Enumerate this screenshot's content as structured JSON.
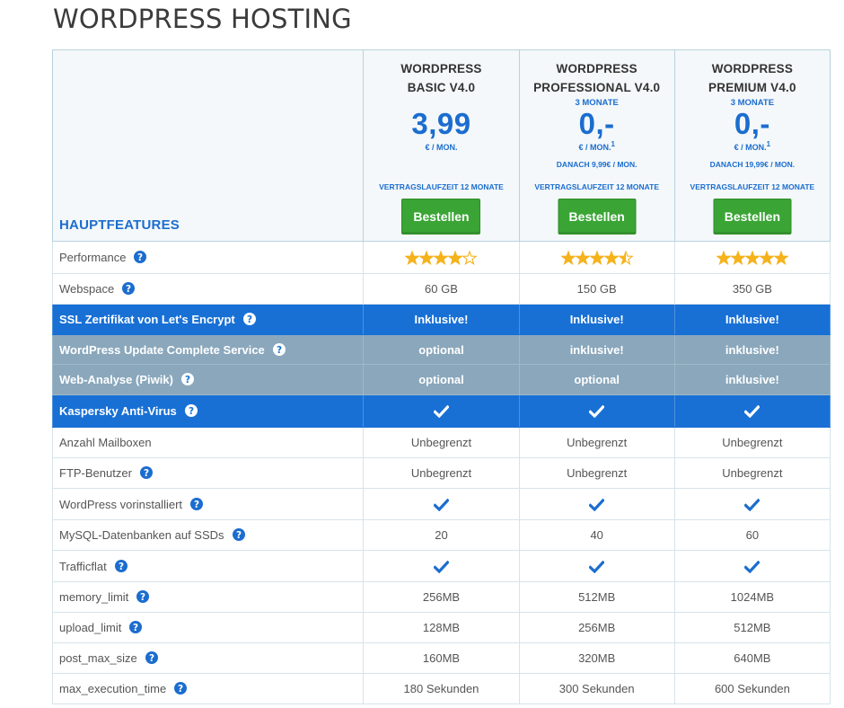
{
  "page": {
    "title": "WORDPRESS HOSTING"
  },
  "table": {
    "feature_header": "HAUPTFEATURES",
    "plans": [
      {
        "name_line1": "WORDPRESS",
        "name_line2": "BASIC V4.0",
        "promo": "",
        "price": "3,99",
        "per": "€ / MON.",
        "footnote": "",
        "after": "",
        "term": "VERTRAGSLAUFZEIT 12 MONATE",
        "order_label": "Bestellen"
      },
      {
        "name_line1": "WORDPRESS",
        "name_line2": "PROFESSIONAL V4.0",
        "promo": "3 MONATE",
        "price": "0,-",
        "per": "€ / MON.",
        "footnote": "1",
        "after": "DANACH 9,99€ / MON.",
        "term": "VERTRAGSLAUFZEIT 12 MONATE",
        "order_label": "Bestellen"
      },
      {
        "name_line1": "WORDPRESS",
        "name_line2": "PREMIUM V4.0",
        "promo": "3 MONATE",
        "price": "0,-",
        "per": "€ / MON.",
        "footnote": "1",
        "after": "DANACH 19,99€ / MON.",
        "term": "VERTRAGSLAUFZEIT 12 MONATE",
        "order_label": "Bestellen"
      }
    ],
    "rows": [
      {
        "label": "Performance",
        "help": true,
        "style": "white",
        "kind": "stars",
        "values": [
          4,
          4.5,
          5
        ]
      },
      {
        "label": "Webspace",
        "help": true,
        "style": "white",
        "kind": "text",
        "values": [
          "60 GB",
          "150 GB",
          "350 GB"
        ]
      },
      {
        "label": "SSL Zertifikat von Let's Encrypt",
        "help": true,
        "style": "blue",
        "kind": "text",
        "values": [
          "Inklusive!",
          "Inklusive!",
          "Inklusive!"
        ]
      },
      {
        "label": "WordPress Update Complete Service",
        "help": true,
        "style": "gray",
        "kind": "text",
        "values": [
          "optional",
          "inklusive!",
          "inklusive!"
        ]
      },
      {
        "label": "Web-Analyse (Piwik)",
        "help": true,
        "style": "gray",
        "kind": "text",
        "values": [
          "optional",
          "optional",
          "inklusive!"
        ]
      },
      {
        "label": "Kaspersky Anti-Virus",
        "help": true,
        "style": "blue",
        "kind": "check",
        "values": [
          true,
          true,
          true
        ]
      },
      {
        "label": "Anzahl Mailboxen",
        "help": false,
        "style": "white",
        "kind": "text",
        "values": [
          "Unbegrenzt",
          "Unbegrenzt",
          "Unbegrenzt"
        ]
      },
      {
        "label": "FTP-Benutzer",
        "help": true,
        "style": "white",
        "kind": "text",
        "values": [
          "Unbegrenzt",
          "Unbegrenzt",
          "Unbegrenzt"
        ]
      },
      {
        "label": "WordPress vorinstalliert",
        "help": true,
        "style": "white",
        "kind": "check",
        "values": [
          true,
          true,
          true
        ]
      },
      {
        "label": "MySQL-Datenbanken auf SSDs",
        "help": true,
        "style": "white",
        "kind": "text",
        "values": [
          "20",
          "40",
          "60"
        ]
      },
      {
        "label": "Trafficflat",
        "help": true,
        "style": "white",
        "kind": "check",
        "values": [
          true,
          true,
          true
        ]
      },
      {
        "label": "memory_limit",
        "help": true,
        "style": "white",
        "kind": "text",
        "values": [
          "256MB",
          "512MB",
          "1024MB"
        ]
      },
      {
        "label": "upload_limit",
        "help": true,
        "style": "white",
        "kind": "text",
        "values": [
          "128MB",
          "256MB",
          "512MB"
        ]
      },
      {
        "label": "post_max_size",
        "help": true,
        "style": "white",
        "kind": "text",
        "values": [
          "160MB",
          "320MB",
          "640MB"
        ]
      },
      {
        "label": "max_execution_time",
        "help": true,
        "style": "white",
        "kind": "text",
        "values": [
          "180 Sekunden",
          "300 Sekunden",
          "600 Sekunden"
        ]
      }
    ]
  },
  "colors": {
    "accent_blue": "#1b6dcf",
    "row_blue": "#1870d5",
    "row_gray": "#8aa7bc",
    "button_green": "#3aa535",
    "star": "#f5b21b"
  },
  "icons": {
    "help": "question-circle-icon",
    "check": "checkmark-icon",
    "star": "star-icon"
  }
}
